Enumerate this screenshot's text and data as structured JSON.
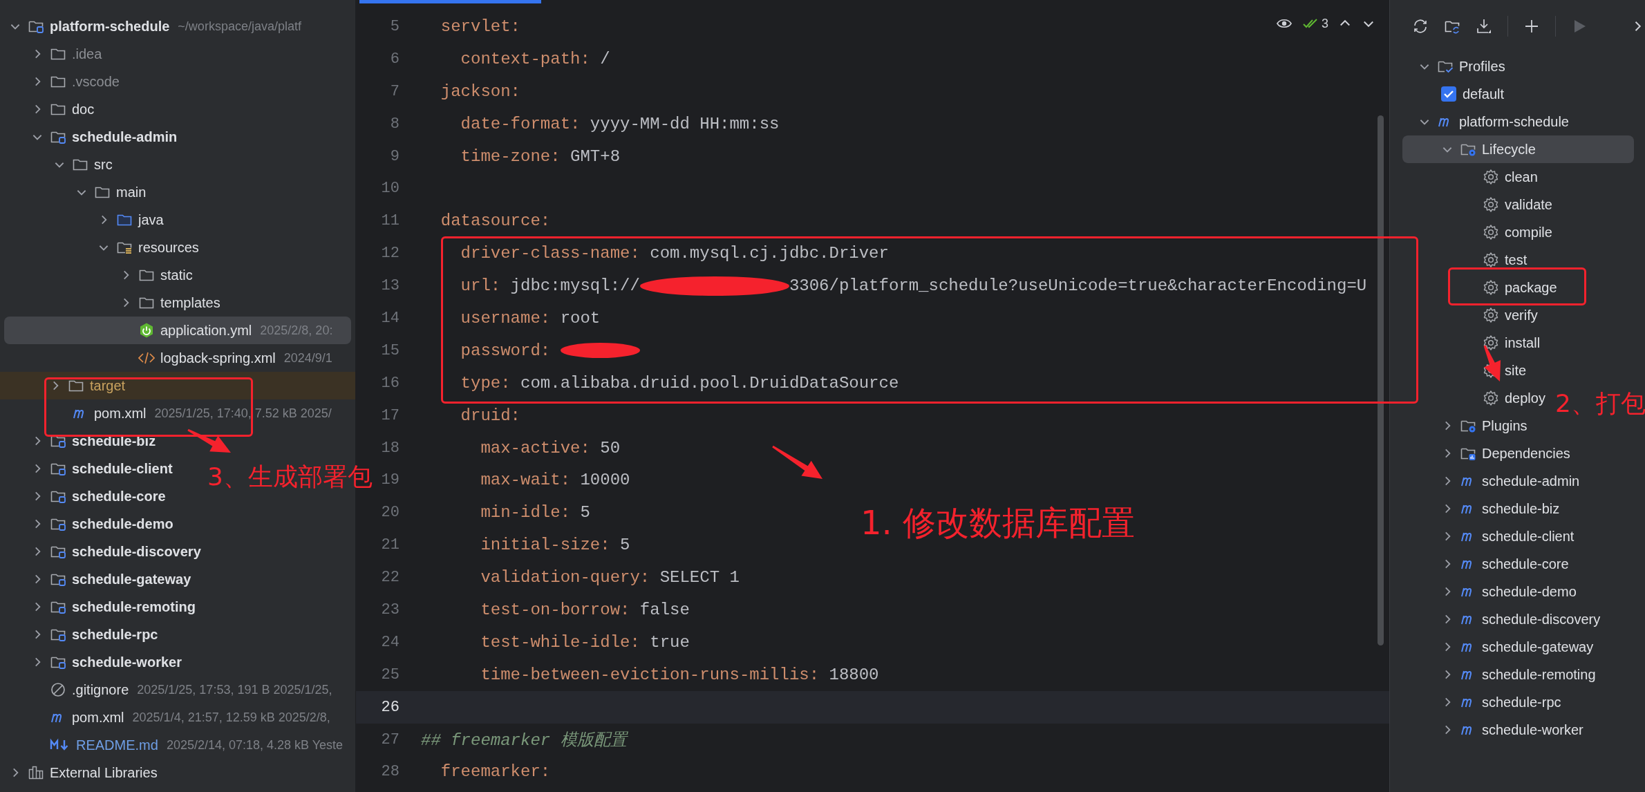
{
  "project_panel": {
    "tree": [
      {
        "label": "platform-schedule",
        "kind": "module",
        "meta": "~/workspace/java/platf",
        "expanded": true,
        "selected": false,
        "children": [
          {
            "label": ".idea",
            "kind": "ignored-folder",
            "expanded": false,
            "selected": false
          },
          {
            "label": ".vscode",
            "kind": "ignored-folder",
            "expanded": false,
            "selected": false
          },
          {
            "label": "doc",
            "kind": "folder",
            "expanded": false,
            "selected": false
          },
          {
            "label": "schedule-admin",
            "kind": "module",
            "expanded": true,
            "selected": false,
            "children": [
              {
                "label": "src",
                "kind": "folder",
                "expanded": true,
                "selected": false,
                "children": [
                  {
                    "label": "main",
                    "kind": "folder",
                    "expanded": true,
                    "selected": false,
                    "children": [
                      {
                        "label": "java",
                        "kind": "source-folder",
                        "expanded": false,
                        "selected": false
                      },
                      {
                        "label": "resources",
                        "kind": "resources-folder",
                        "expanded": true,
                        "selected": false,
                        "children": [
                          {
                            "label": "static",
                            "kind": "folder",
                            "expanded": false,
                            "selected": false
                          },
                          {
                            "label": "templates",
                            "kind": "folder",
                            "expanded": false,
                            "selected": false
                          },
                          {
                            "label": "application.yml",
                            "kind": "spring",
                            "meta": "2025/2/8, 20:",
                            "selected": true
                          },
                          {
                            "label": "logback-spring.xml",
                            "kind": "xml",
                            "meta": "2024/9/1",
                            "selected": false
                          }
                        ]
                      }
                    ]
                  }
                ]
              },
              {
                "label": "target",
                "kind": "excluded-folder",
                "expanded": false,
                "selected": false
              },
              {
                "label": "pom.xml",
                "kind": "maven",
                "meta": "2025/1/25, 17:40, 7.52 kB 2025/",
                "selected": false
              }
            ]
          },
          {
            "label": "schedule-biz",
            "kind": "module",
            "expanded": false,
            "selected": false
          },
          {
            "label": "schedule-client",
            "kind": "module",
            "expanded": false,
            "selected": false
          },
          {
            "label": "schedule-core",
            "kind": "module",
            "expanded": false,
            "selected": false
          },
          {
            "label": "schedule-demo",
            "kind": "module",
            "expanded": false,
            "selected": false
          },
          {
            "label": "schedule-discovery",
            "kind": "module",
            "expanded": false,
            "selected": false
          },
          {
            "label": "schedule-gateway",
            "kind": "module",
            "expanded": false,
            "selected": false
          },
          {
            "label": "schedule-remoting",
            "kind": "module",
            "expanded": false,
            "selected": false
          },
          {
            "label": "schedule-rpc",
            "kind": "module",
            "expanded": false,
            "selected": false
          },
          {
            "label": "schedule-worker",
            "kind": "module",
            "expanded": false,
            "selected": false
          },
          {
            "label": ".gitignore",
            "kind": "ignore",
            "meta": "2025/1/25, 17:53, 191 B 2025/1/25,",
            "selected": false
          },
          {
            "label": "pom.xml",
            "kind": "maven",
            "meta": "2025/1/4, 21:57, 12.59 kB 2025/2/8,",
            "selected": false
          },
          {
            "label": "README.md",
            "kind": "markdown",
            "meta": "2025/2/14, 07:18, 4.28 kB Yeste",
            "selected": false
          }
        ]
      },
      {
        "label": "External Libraries",
        "kind": "libraries",
        "expanded": false,
        "selected": false
      }
    ]
  },
  "editor": {
    "inspection_count": "3",
    "lines": [
      {
        "no": "5",
        "kind": "pair",
        "key": "  servlet:",
        "current": false
      },
      {
        "no": "6",
        "kind": "pair",
        "key": "    context-path:",
        "value": "/",
        "current": false
      },
      {
        "no": "7",
        "kind": "pair",
        "key": "  jackson:",
        "current": false
      },
      {
        "no": "8",
        "kind": "pair",
        "key": "    date-format:",
        "value": "yyyy-MM-dd HH:mm:ss",
        "current": false
      },
      {
        "no": "9",
        "kind": "pair",
        "key": "    time-zone:",
        "value": "GMT+8",
        "current": false
      },
      {
        "no": "10",
        "kind": "blank",
        "current": false
      },
      {
        "no": "11",
        "kind": "pair",
        "key": "  datasource:",
        "current": false
      },
      {
        "no": "12",
        "kind": "pair",
        "key": "    driver-class-name:",
        "value": "com.mysql.cj.jdbc.Driver",
        "current": false
      },
      {
        "no": "13",
        "kind": "pair",
        "key": "    url:",
        "value": "jdbc:mysql://",
        "redacted": true,
        "value_after": "3306/platform_schedule?useUnicode=true&characterEncoding=U",
        "current": false
      },
      {
        "no": "14",
        "kind": "pair",
        "key": "    username:",
        "value": "root",
        "current": false
      },
      {
        "no": "15",
        "kind": "pair",
        "key": "    password:",
        "redacted": true,
        "current": false
      },
      {
        "no": "16",
        "kind": "pair",
        "key": "    type:",
        "value": "com.alibaba.druid.pool.DruidDataSource",
        "current": false
      },
      {
        "no": "17",
        "kind": "pair",
        "key": "    druid:",
        "current": false
      },
      {
        "no": "18",
        "kind": "pair",
        "key": "      max-active:",
        "value": "50",
        "current": false
      },
      {
        "no": "19",
        "kind": "pair",
        "key": "      max-wait:",
        "value": "10000",
        "current": false
      },
      {
        "no": "20",
        "kind": "pair",
        "key": "      min-idle:",
        "value": "5",
        "current": false
      },
      {
        "no": "21",
        "kind": "pair",
        "key": "      initial-size:",
        "value": "5",
        "current": false
      },
      {
        "no": "22",
        "kind": "pair",
        "key": "      validation-query:",
        "value": "SELECT 1",
        "current": false
      },
      {
        "no": "23",
        "kind": "pair",
        "key": "      test-on-borrow:",
        "value": "false",
        "current": false
      },
      {
        "no": "24",
        "kind": "pair",
        "key": "      test-while-idle:",
        "value": "true",
        "current": false
      },
      {
        "no": "25",
        "kind": "pair",
        "key": "      time-between-eviction-runs-millis:",
        "value": "18800",
        "current": false
      },
      {
        "no": "26",
        "kind": "blank",
        "current": true
      },
      {
        "no": "27",
        "kind": "comment",
        "text": "## freemarker 模版配置",
        "current": false
      },
      {
        "no": "28",
        "kind": "pair",
        "key": "  freemarker:",
        "current": false
      }
    ]
  },
  "maven_panel": {
    "tree": [
      {
        "label": "Profiles",
        "kind": "profiles",
        "expanded": true,
        "selected": false,
        "children": [
          {
            "label": "default",
            "kind": "checkbox",
            "checked": true,
            "selected": false
          }
        ]
      },
      {
        "label": "platform-schedule",
        "kind": "maven",
        "expanded": true,
        "selected": false,
        "children": [
          {
            "label": "Lifecycle",
            "kind": "lifecycle",
            "expanded": true,
            "selected": true,
            "children": [
              {
                "label": "clean",
                "kind": "goal",
                "selected": false
              },
              {
                "label": "validate",
                "kind": "goal",
                "selected": false
              },
              {
                "label": "compile",
                "kind": "goal",
                "selected": false
              },
              {
                "label": "test",
                "kind": "goal",
                "selected": false
              },
              {
                "label": "package",
                "kind": "goal",
                "selected": false
              },
              {
                "label": "verify",
                "kind": "goal",
                "selected": false
              },
              {
                "label": "install",
                "kind": "goal",
                "selected": false
              },
              {
                "label": "site",
                "kind": "goal",
                "selected": false
              },
              {
                "label": "deploy",
                "kind": "goal",
                "selected": false
              }
            ]
          },
          {
            "label": "Plugins",
            "kind": "plugins",
            "expanded": false,
            "selected": false
          },
          {
            "label": "Dependencies",
            "kind": "dependencies",
            "expanded": false,
            "selected": false
          },
          {
            "label": "schedule-admin",
            "kind": "maven",
            "expanded": false,
            "selected": false
          },
          {
            "label": "schedule-biz",
            "kind": "maven",
            "expanded": false,
            "selected": false
          },
          {
            "label": "schedule-client",
            "kind": "maven",
            "expanded": false,
            "selected": false
          },
          {
            "label": "schedule-core",
            "kind": "maven",
            "expanded": false,
            "selected": false
          },
          {
            "label": "schedule-demo",
            "kind": "maven",
            "expanded": false,
            "selected": false
          },
          {
            "label": "schedule-discovery",
            "kind": "maven",
            "expanded": false,
            "selected": false
          },
          {
            "label": "schedule-gateway",
            "kind": "maven",
            "expanded": false,
            "selected": false
          },
          {
            "label": "schedule-remoting",
            "kind": "maven",
            "expanded": false,
            "selected": false
          },
          {
            "label": "schedule-rpc",
            "kind": "maven",
            "expanded": false,
            "selected": false
          },
          {
            "label": "schedule-worker",
            "kind": "maven",
            "expanded": false,
            "selected": false
          }
        ]
      }
    ]
  },
  "annotations": [
    {
      "text": "1. 修改数据库配置"
    },
    {
      "text": "2、打包"
    },
    {
      "text": "3、生成部署包"
    }
  ]
}
